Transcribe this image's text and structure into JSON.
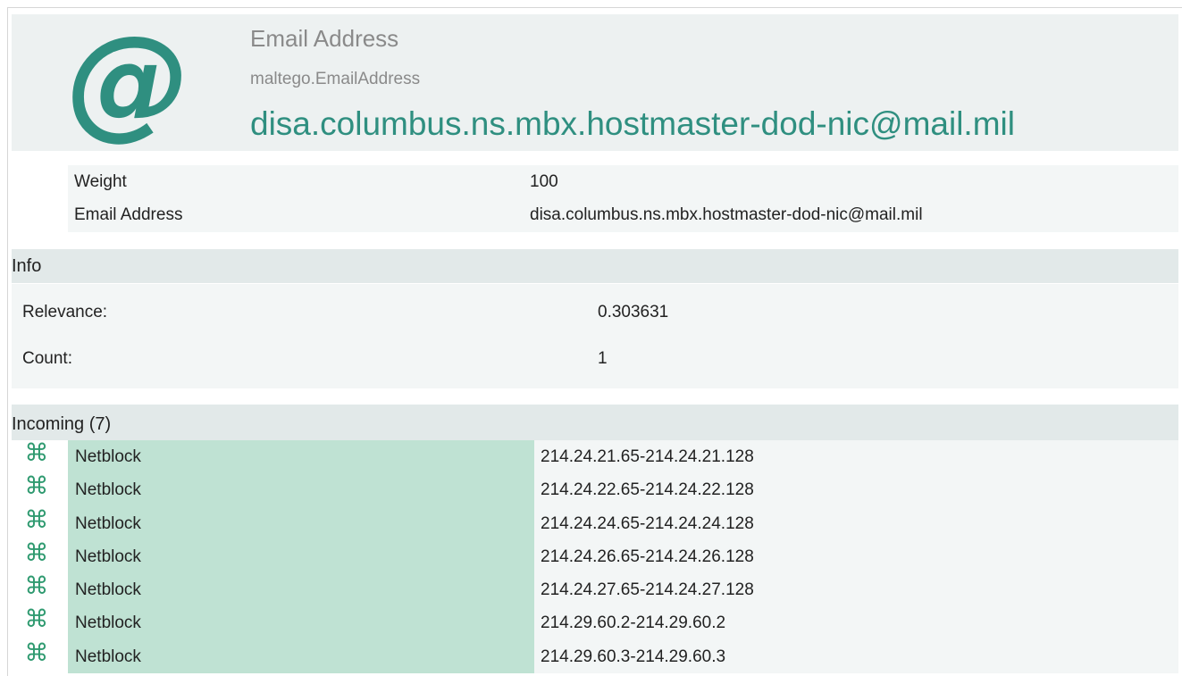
{
  "entity": {
    "icon": "at-sign-icon",
    "icon_glyph": "@",
    "type_label": "Email Address",
    "class_name": "maltego.EmailAddress",
    "value": "disa.columbus.ns.mbx.hostmaster-dod-nic@mail.mil",
    "accent_color": "#2f8f80"
  },
  "properties": [
    {
      "key": "Weight",
      "value": "100"
    },
    {
      "key": "Email Address",
      "value": "disa.columbus.ns.mbx.hostmaster-dod-nic@mail.mil"
    }
  ],
  "info": {
    "title": "Info",
    "rows": [
      {
        "key": "Relevance:",
        "value": "0.303631"
      },
      {
        "key": "Count:",
        "value": "1"
      }
    ]
  },
  "incoming": {
    "title": "Incoming (7)",
    "icon": "netblock-icon",
    "icon_glyph": "⌘",
    "rows": [
      {
        "type": "Netblock",
        "value": "214.24.21.65-214.24.21.128"
      },
      {
        "type": "Netblock",
        "value": "214.24.22.65-214.24.22.128"
      },
      {
        "type": "Netblock",
        "value": "214.24.24.65-214.24.24.128"
      },
      {
        "type": "Netblock",
        "value": "214.24.26.65-214.24.26.128"
      },
      {
        "type": "Netblock",
        "value": "214.24.27.65-214.24.27.128"
      },
      {
        "type": "Netblock",
        "value": "214.29.60.2-214.29.60.2"
      },
      {
        "type": "Netblock",
        "value": "214.29.60.3-214.29.60.3"
      }
    ]
  }
}
